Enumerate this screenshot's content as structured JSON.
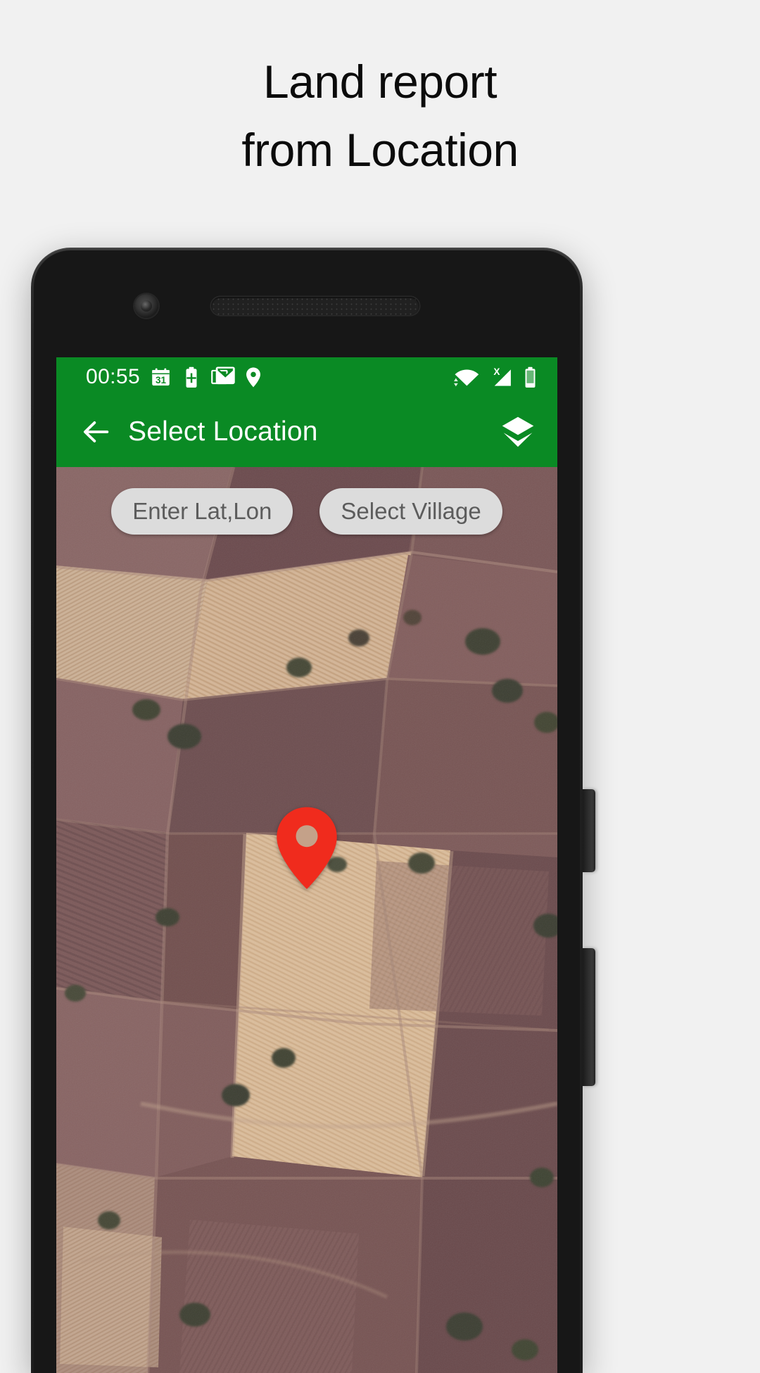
{
  "promo": {
    "line1": "Land report",
    "line2": "from Location"
  },
  "device": {
    "front_camera": "front-camera",
    "speaker": "earpiece-speaker",
    "power_button": "power-button",
    "volume_button": "volume-button"
  },
  "status_bar": {
    "time": "00:55",
    "background": "#0a8a24",
    "left_icons": [
      "calendar-icon",
      "battery-plus-icon",
      "gmail-icon",
      "location-pin-icon"
    ],
    "calendar_day": "31",
    "right_icons": [
      "wifi-icon",
      "no-sim-signal-icon",
      "battery-icon"
    ]
  },
  "app_bar": {
    "back_label": "back-arrow",
    "title": "Select Location",
    "layers_label": "map-layers",
    "background": "#0a8a24",
    "text_color": "#ffffff"
  },
  "map": {
    "chips": [
      {
        "label": "Enter Lat,Lon"
      },
      {
        "label": "Select Village"
      }
    ],
    "chip_bg": "#dcdcdc",
    "chip_text": "#5c5c5c",
    "marker_color": "#f02b1d",
    "marker_name": "location-marker",
    "imagery": "satellite"
  }
}
